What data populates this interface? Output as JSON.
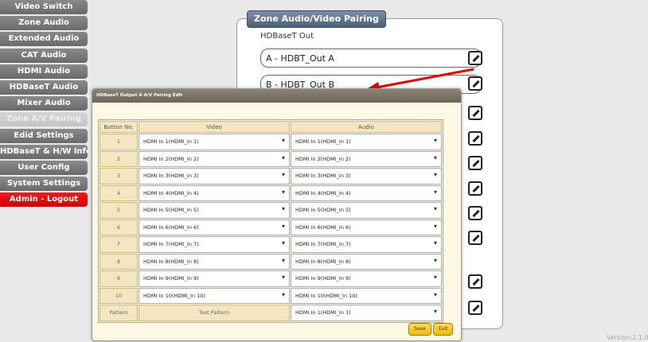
{
  "sidebar": {
    "items": [
      {
        "label": "Video Switch"
      },
      {
        "label": "Zone Audio"
      },
      {
        "label": "Extended Audio"
      },
      {
        "label": "CAT Audio"
      },
      {
        "label": "HDMI Audio"
      },
      {
        "label": "HDBaseT Audio"
      },
      {
        "label": "Mixer Audio"
      },
      {
        "label": "Zone A/V Pairing",
        "active": true
      },
      {
        "label": "Edid Settings"
      },
      {
        "label": "HDBaseT & H/W Info"
      },
      {
        "label": "User Config"
      },
      {
        "label": "System Settings"
      },
      {
        "label": "Admin - Logout",
        "logout": true
      }
    ]
  },
  "zone": {
    "title": "Zone Audio/Video Pairing",
    "subtitle": "HDBaseT Out",
    "rows": [
      "A - HDBT_Out A",
      "B - HDBT_Out B"
    ]
  },
  "dialog": {
    "title": "HDBaseT Output A A/V Pairing Edit",
    "headers": {
      "button": "Button No.",
      "video": "Video",
      "audio": "Audio"
    },
    "rows": [
      {
        "no": "1",
        "video": "HDMI In 1(HDMI_In 1)",
        "audio": "HDMI In 1(HDMI_In 1)"
      },
      {
        "no": "2",
        "video": "HDMI In 2(HDMI_In 2)",
        "audio": "HDMI In 2(HDMI_In 2)"
      },
      {
        "no": "3",
        "video": "HDMI In 3(HDMI_In 3)",
        "audio": "HDMI In 3(HDMI_In 3)"
      },
      {
        "no": "4",
        "video": "HDMI In 4(HDMI_In 4)",
        "audio": "HDMI In 4(HDMI_In 4)"
      },
      {
        "no": "5",
        "video": "HDMI In 5(HDMI_In 5)",
        "audio": "HDMI In 5(HDMI_In 5)"
      },
      {
        "no": "6",
        "video": "HDMI In 6(HDMI_In 6)",
        "audio": "HDMI In 6(HDMI_In 6)"
      },
      {
        "no": "7",
        "video": "HDMI In 7(HDMI_In 7)",
        "audio": "HDMI In 7(HDMI_In 7)"
      },
      {
        "no": "8",
        "video": "HDMI In 8(HDMI_In 8)",
        "audio": "HDMI In 8(HDMI_In 8)"
      },
      {
        "no": "9",
        "video": "HDMI In 9(HDMI_In 9)",
        "audio": "HDMI In 9(HDMI_In 9)"
      },
      {
        "no": "10",
        "video": "HDMI In 10(HDMI_In 10)",
        "audio": "HDMI In 10(HDMI_In 10)"
      }
    ],
    "pattern": {
      "label": "Pattern",
      "video": "Test Pattern",
      "audio": "HDMI In 1(HDMI_In 1)"
    },
    "save": "Save",
    "exit": "Exit"
  },
  "version": "Version:2.1.0",
  "colors": {
    "accent": "#f2b807",
    "logout": "#e60000",
    "arrow": "#e00000"
  }
}
